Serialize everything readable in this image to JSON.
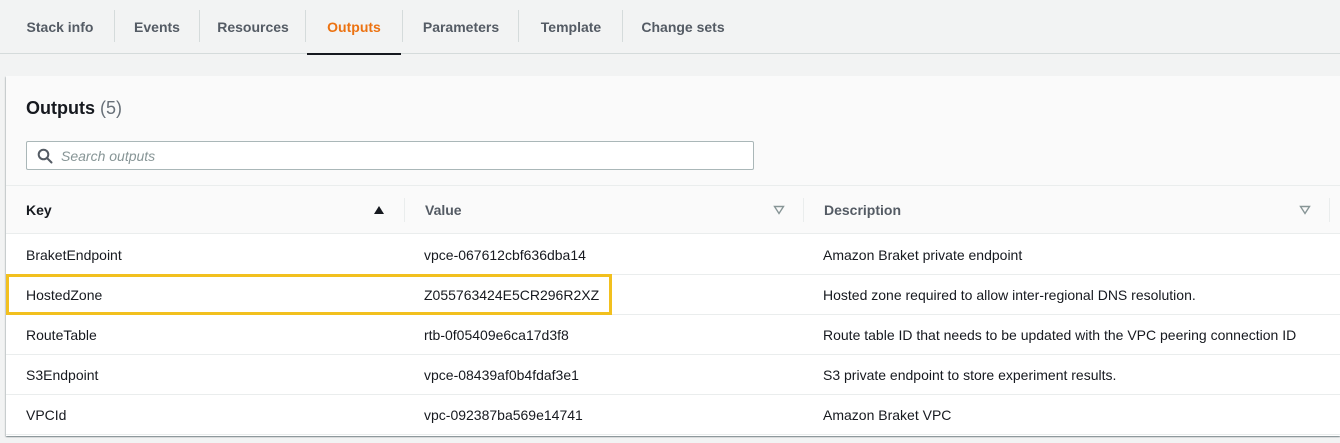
{
  "tabs": [
    {
      "label": "Stack info",
      "active": false
    },
    {
      "label": "Events",
      "active": false
    },
    {
      "label": "Resources",
      "active": false
    },
    {
      "label": "Outputs",
      "active": true
    },
    {
      "label": "Parameters",
      "active": false
    },
    {
      "label": "Template",
      "active": false
    },
    {
      "label": "Change sets",
      "active": false
    }
  ],
  "outputs": {
    "title": "Outputs",
    "count": "(5)",
    "search_placeholder": "Search outputs",
    "columns": {
      "key": "Key",
      "value": "Value",
      "description": "Description"
    },
    "rows": [
      {
        "key": "BraketEndpoint",
        "value": "vpce-067612cbf636dba14",
        "description": "Amazon Braket private endpoint"
      },
      {
        "key": "HostedZone",
        "value": "Z055763424E5CR296R2XZ",
        "description": "Hosted zone required to allow inter-regional DNS resolution."
      },
      {
        "key": "RouteTable",
        "value": "rtb-0f05409e6ca17d3f8",
        "description": "Route table ID that needs to be updated with the VPC peering connection ID"
      },
      {
        "key": "S3Endpoint",
        "value": "vpce-08439af0b4fdaf3e1",
        "description": "S3 private endpoint to store experiment results."
      },
      {
        "key": "VPCId",
        "value": "vpc-092387ba569e14741",
        "description": "Amazon Braket VPC"
      }
    ]
  },
  "colors": {
    "active_tab": "#ec7211",
    "highlight": "#f2c01e"
  }
}
